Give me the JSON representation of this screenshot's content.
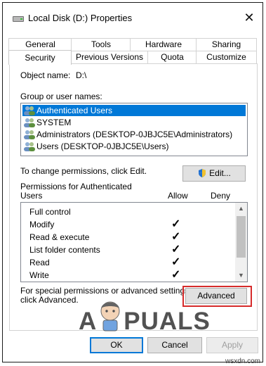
{
  "window": {
    "title": "Local Disk (D:) Properties",
    "close_glyph": "✕"
  },
  "tabs_row1": [
    "General",
    "Tools",
    "Hardware",
    "Sharing"
  ],
  "tabs_row2": [
    "Security",
    "Previous Versions",
    "Quota",
    "Customize"
  ],
  "object": {
    "label": "Object name:",
    "value": "D:\\"
  },
  "group": {
    "label": "Group or user names:",
    "users": [
      {
        "name": "Authenticated Users",
        "selected": true,
        "icon": "users-group-icon"
      },
      {
        "name": "SYSTEM",
        "selected": false,
        "icon": "users-group-icon"
      },
      {
        "name": "Administrators (DESKTOP-0JBJC5E\\Administrators)",
        "selected": false,
        "icon": "users-group-icon"
      },
      {
        "name": "Users (DESKTOP-0JBJC5E\\Users)",
        "selected": false,
        "icon": "users-group-icon"
      }
    ]
  },
  "change_text": "To change permissions, click Edit.",
  "edit_label": "Edit...",
  "permissions": {
    "header_line1": "Permissions for Authenticated",
    "header_line2": "Users",
    "allow": "Allow",
    "deny": "Deny",
    "rows": [
      {
        "name": "Full control",
        "allow": false,
        "deny": false
      },
      {
        "name": "Modify",
        "allow": true,
        "deny": false
      },
      {
        "name": "Read & execute",
        "allow": true,
        "deny": false
      },
      {
        "name": "List folder contents",
        "allow": true,
        "deny": false
      },
      {
        "name": "Read",
        "allow": true,
        "deny": false
      },
      {
        "name": "Write",
        "allow": true,
        "deny": false
      }
    ]
  },
  "special": {
    "line1": "For special permissions or advanced settings,",
    "line2": "click Advanced."
  },
  "advanced_label": "Advanced",
  "footer": {
    "ok": "OK",
    "cancel": "Cancel",
    "apply": "Apply"
  },
  "watermark": {
    "left": "A",
    "right": "PUALS",
    "site": "wsxdn.com"
  },
  "colors": {
    "selection": "#0078d7",
    "highlight_border": "#d62b2b"
  }
}
